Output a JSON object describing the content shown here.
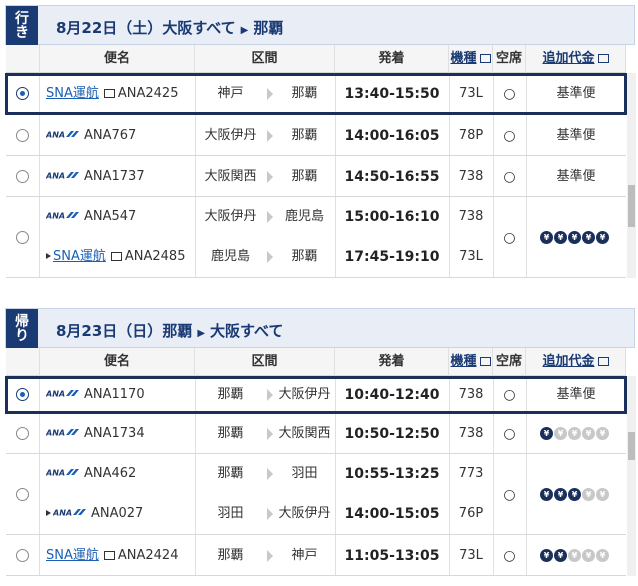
{
  "outbound": {
    "tag": "行き",
    "date": "8月22日（土）",
    "from": "大阪すべて",
    "to": "那覇",
    "rows": [
      {
        "selected": true,
        "legs": [
          {
            "sna": true,
            "label_sna": "SNA運航",
            "flight": "ANA2425",
            "dep": "神戸",
            "arr": "那覇",
            "time": "13:40-15:50",
            "ac": "73L"
          }
        ],
        "vacancy": "○",
        "fare": "基準便",
        "coins": null
      },
      {
        "selected": false,
        "legs": [
          {
            "sna": false,
            "flight": "ANA767",
            "dep": "大阪伊丹",
            "arr": "那覇",
            "time": "14:00-16:05",
            "ac": "78P"
          }
        ],
        "vacancy": "○",
        "fare": "基準便",
        "coins": null
      },
      {
        "selected": false,
        "legs": [
          {
            "sna": false,
            "flight": "ANA1737",
            "dep": "大阪関西",
            "arr": "那覇",
            "time": "14:50-16:55",
            "ac": "738"
          }
        ],
        "vacancy": "○",
        "fare": "基準便",
        "coins": null
      },
      {
        "selected": false,
        "legs": [
          {
            "sna": false,
            "flight": "ANA547",
            "dep": "大阪伊丹",
            "arr": "鹿児島",
            "time": "15:00-16:10",
            "ac": "738"
          },
          {
            "sna": true,
            "label_sna": "SNA運航",
            "flight": "ANA2485",
            "dep": "鹿児島",
            "arr": "那覇",
            "time": "17:45-19:10",
            "ac": "73L"
          }
        ],
        "vacancy": "○",
        "fare": "",
        "coins": [
          1,
          1,
          1,
          1,
          1
        ]
      }
    ]
  },
  "inbound": {
    "tag": "帰り",
    "date": "8月23日（日）",
    "from": "那覇",
    "to": "大阪すべて",
    "rows": [
      {
        "selected": true,
        "legs": [
          {
            "sna": false,
            "flight": "ANA1170",
            "dep": "那覇",
            "arr": "大阪伊丹",
            "time": "10:40-12:40",
            "ac": "738"
          }
        ],
        "vacancy": "○",
        "fare": "基準便",
        "coins": null
      },
      {
        "selected": false,
        "legs": [
          {
            "sna": false,
            "flight": "ANA1734",
            "dep": "那覇",
            "arr": "大阪関西",
            "time": "10:50-12:50",
            "ac": "738"
          }
        ],
        "vacancy": "○",
        "fare": "",
        "coins": [
          1,
          0,
          0,
          0,
          0
        ]
      },
      {
        "selected": false,
        "legs": [
          {
            "sna": false,
            "flight": "ANA462",
            "dep": "那覇",
            "arr": "羽田",
            "time": "10:55-13:25",
            "ac": "773"
          },
          {
            "sna": false,
            "connect": true,
            "flight": "ANA027",
            "dep": "羽田",
            "arr": "大阪伊丹",
            "time": "14:00-15:05",
            "ac": "76P"
          }
        ],
        "vacancy": "○",
        "fare": "",
        "coins": [
          1,
          1,
          1,
          0,
          0
        ]
      },
      {
        "selected": false,
        "legs": [
          {
            "sna": true,
            "label_sna": "SNA運航",
            "flight": "ANA2424",
            "dep": "那覇",
            "arr": "神戸",
            "time": "11:05-13:05",
            "ac": "73L"
          }
        ],
        "vacancy": "○",
        "fare": "",
        "coins": [
          1,
          1,
          0,
          0,
          0
        ]
      }
    ]
  },
  "headers": {
    "flight": "便名",
    "segment": "区間",
    "time": "発着",
    "aircraft": "機種",
    "vacancy": "空席",
    "fare": "追加代金"
  },
  "colors": {
    "navy": "#1a3a73",
    "link": "#1a5fb4",
    "coin": "#1a2f5a",
    "coin_off": "#c8c8c8"
  }
}
